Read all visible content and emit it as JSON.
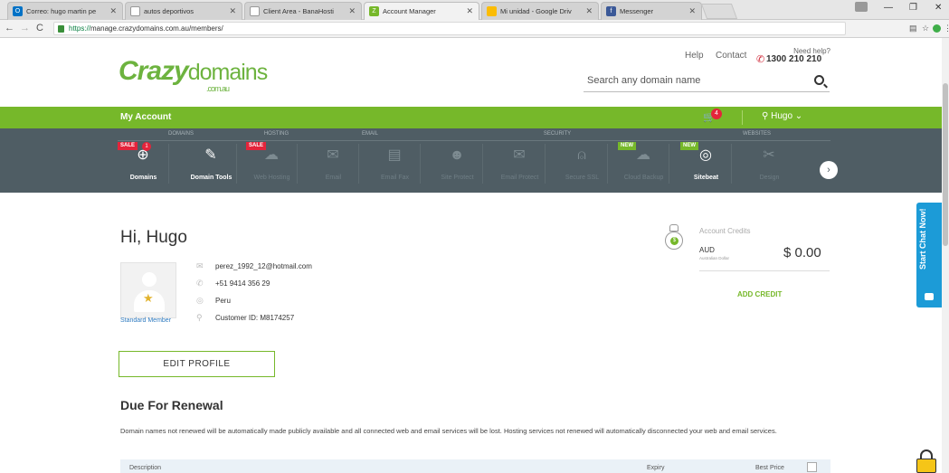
{
  "browser": {
    "tabs": [
      {
        "title": "Correo: hugo martin pe",
        "fav": "O",
        "favcolor": "#0072c6"
      },
      {
        "title": "autos deportivos",
        "fav": "",
        "favcolor": "#ffffff"
      },
      {
        "title": "Client Area - BanaHosti",
        "fav": "",
        "favcolor": "#ffffff"
      },
      {
        "title": "Account Manager",
        "fav": "Z",
        "favcolor": "#76b82a"
      },
      {
        "title": "Mi unidad - Google Driv",
        "fav": "",
        "favcolor": "#fbbc04"
      },
      {
        "title": "Messenger",
        "fav": "f",
        "favcolor": "#3b5998"
      }
    ],
    "url_scheme": "https://",
    "url_rest": "manage.crazydomains.com.au/members/"
  },
  "header": {
    "logo_main": "Crazy",
    "logo_domains": "domains",
    "logo_tld": ".com.au",
    "help": "Help",
    "contact": "Contact",
    "need_help": "Need help?",
    "phone": "1300 210 210",
    "search_placeholder": "Search any domain name"
  },
  "account_bar": {
    "title": "My Account",
    "cart_count": "4",
    "user": "Hugo"
  },
  "categories": [
    "DOMAINS",
    "HOSTING",
    "EMAIL",
    "SECURITY",
    "WEBSITES"
  ],
  "services": [
    {
      "label": "Domains",
      "badge": "SALE",
      "count": "1",
      "icon": "globe-icon"
    },
    {
      "label": "Domain Tools",
      "icon": "wrench-icon"
    },
    {
      "label": "Web Hosting",
      "badge": "SALE",
      "icon": "cloud-icon"
    },
    {
      "label": "Email",
      "icon": "envelope-icon"
    },
    {
      "label": "Email Fax",
      "icon": "fax-icon"
    },
    {
      "label": "Site Protect",
      "icon": "shield-icon"
    },
    {
      "label": "Email Protect",
      "icon": "email-protect-icon"
    },
    {
      "label": "Secure SSL",
      "icon": "padlock-icon"
    },
    {
      "label": "Cloud Backup",
      "badge": "NEW",
      "icon": "cloud-backup-icon"
    },
    {
      "label": "Sitebeat",
      "badge": "NEW",
      "icon": "target-icon"
    },
    {
      "label": "Design",
      "icon": "design-icon"
    }
  ],
  "profile": {
    "greeting": "Hi, Hugo",
    "member_level": "Standard Member",
    "email": "perez_1992_12@hotmail.com",
    "phone": "+51 9414 356 29",
    "country": "Peru",
    "customer_id": "Customer ID: M8174257",
    "edit_label": "EDIT PROFILE"
  },
  "credits": {
    "heading": "Account Credits",
    "currency": "AUD",
    "currency_name": "Australian Dollar",
    "amount": "$ 0.00",
    "add_label": "ADD CREDIT"
  },
  "renewal": {
    "heading": "Due For Renewal",
    "text": "Domain names not renewed will be automatically made publicly available and all connected web and email services will be lost. Hosting services not renewed will automatically disconnected your web and email services.",
    "col_description": "Description",
    "col_expiry": "Expiry",
    "col_best_price": "Best Price"
  },
  "chat": {
    "label": "Start Chat Now!"
  },
  "colors": {
    "brand_green": "#76b82a",
    "service_bar": "#4f5d64",
    "chat_blue": "#1c9bd7"
  }
}
